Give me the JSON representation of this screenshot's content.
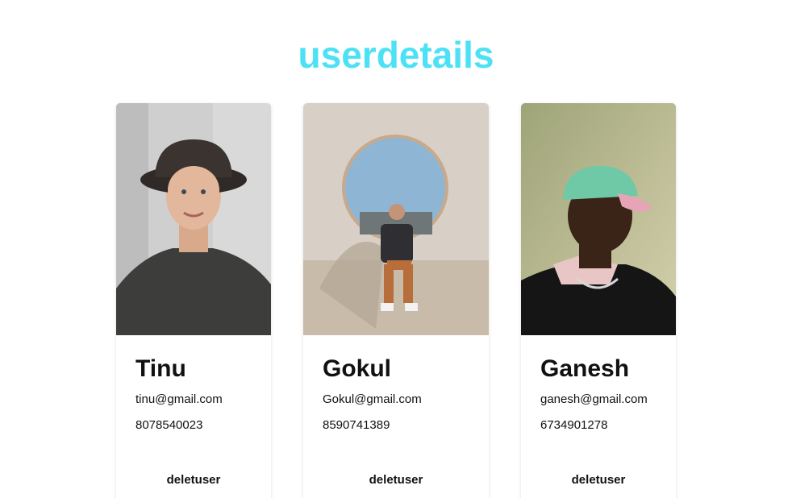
{
  "page": {
    "title": "userdetails",
    "title_color": "#4de1f5"
  },
  "users": [
    {
      "name": "Tinu",
      "email": "tinu@gmail.com",
      "phone": "8078540023",
      "delete_label": "deletuser"
    },
    {
      "name": "Gokul",
      "email": "Gokul@gmail.com",
      "phone": "8590741389",
      "delete_label": "deletuser"
    },
    {
      "name": "Ganesh",
      "email": "ganesh@gmail.com",
      "phone": "6734901278",
      "delete_label": "deletuser"
    }
  ]
}
